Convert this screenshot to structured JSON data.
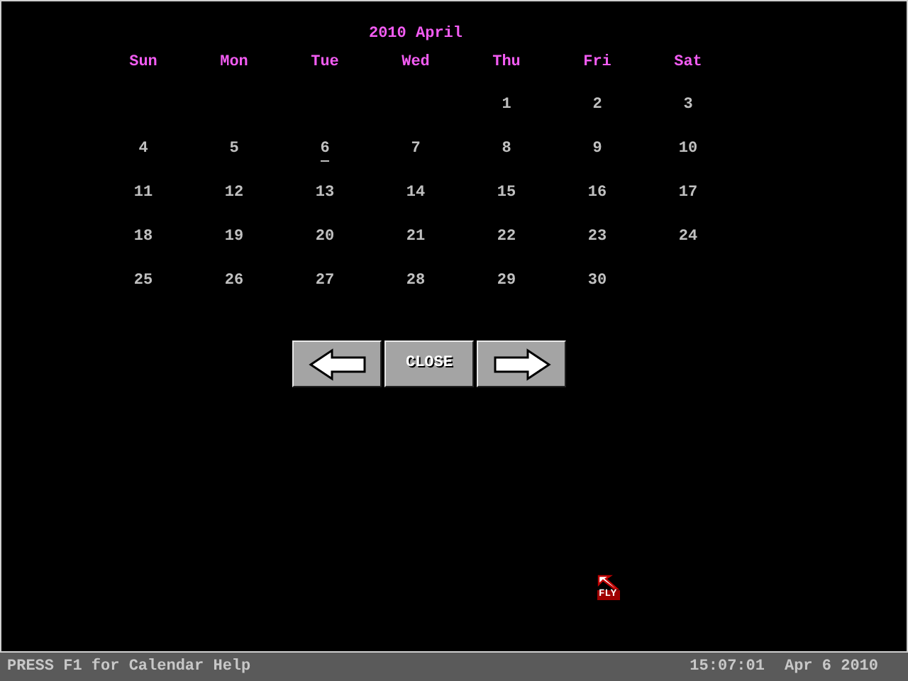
{
  "calendar": {
    "title": "2010 April",
    "weekdays": [
      "Sun",
      "Mon",
      "Tue",
      "Wed",
      "Thu",
      "Fri",
      "Sat"
    ],
    "weeks": [
      {
        "days": [
          {
            "label": "1",
            "selected": false
          },
          {
            "label": "2",
            "selected": false
          },
          {
            "label": "3",
            "selected": false
          }
        ]
      },
      {
        "days": [
          {
            "label": "4",
            "selected": false
          },
          {
            "label": "5",
            "selected": false
          },
          {
            "label": "6",
            "selected": true
          },
          {
            "label": "7",
            "selected": false
          },
          {
            "label": "8",
            "selected": false
          },
          {
            "label": "9",
            "selected": false
          },
          {
            "label": "10",
            "selected": false
          }
        ]
      },
      {
        "days": [
          {
            "label": "11",
            "selected": false
          },
          {
            "label": "12",
            "selected": false
          },
          {
            "label": "13",
            "selected": false
          },
          {
            "label": "14",
            "selected": false
          },
          {
            "label": "15",
            "selected": false
          },
          {
            "label": "16",
            "selected": false
          },
          {
            "label": "17",
            "selected": false
          }
        ]
      },
      {
        "days": [
          {
            "label": "18",
            "selected": false
          },
          {
            "label": "19",
            "selected": false
          },
          {
            "label": "20",
            "selected": false
          },
          {
            "label": "21",
            "selected": false
          },
          {
            "label": "22",
            "selected": false
          },
          {
            "label": "23",
            "selected": false
          },
          {
            "label": "24",
            "selected": false
          }
        ]
      },
      {
        "days": [
          {
            "label": "25",
            "selected": false
          },
          {
            "label": "26",
            "selected": false
          },
          {
            "label": "27",
            "selected": false
          },
          {
            "label": "28",
            "selected": false
          },
          {
            "label": "29",
            "selected": false
          },
          {
            "label": "30",
            "selected": false
          }
        ]
      }
    ]
  },
  "buttons": [
    {
      "kind": "prev"
    },
    {
      "kind": "text",
      "label": "CLOSE"
    },
    {
      "kind": "next"
    }
  ],
  "cursor": {
    "label": "FLY"
  },
  "status_bar": {
    "help": "PRESS F1 for Calendar Help",
    "time": "15:07:01",
    "date": "Apr 6 2010"
  }
}
